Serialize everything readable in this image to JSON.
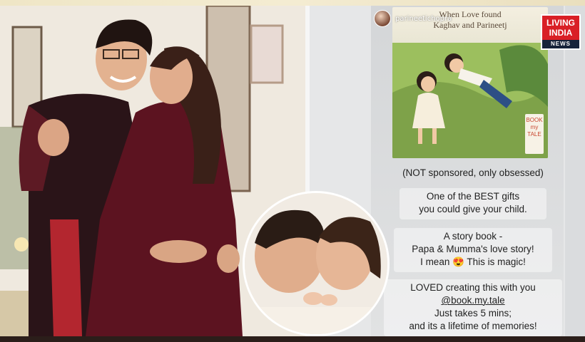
{
  "story": {
    "username": "parineetichopra",
    "book_title_line1": "When Love found",
    "book_title_line2": "Kaghav and Parineetj",
    "book_logo_text": "BOOK my TALE",
    "captions": {
      "c1": "(NOT sponsored, only obsessed)",
      "c2_l1": "One of the BEST gifts",
      "c2_l2": "you could give your child.",
      "c3_l1": "A story book -",
      "c3_l2": "Papa & Mumma's love story!",
      "c3_l3": "I mean 😍 This is magic!",
      "c4_l1": "LOVED creating this with you",
      "c4_l2": "@book.my.tale",
      "c4_l3": "Just takes 5 mins;",
      "c4_l4": "and its a lifetime of memories!"
    }
  },
  "logo": {
    "line1": "LIVING",
    "line2": "INDIA",
    "line3": "NEWS",
    "colors": {
      "red": "#d91f26",
      "navy": "#16233a"
    }
  }
}
